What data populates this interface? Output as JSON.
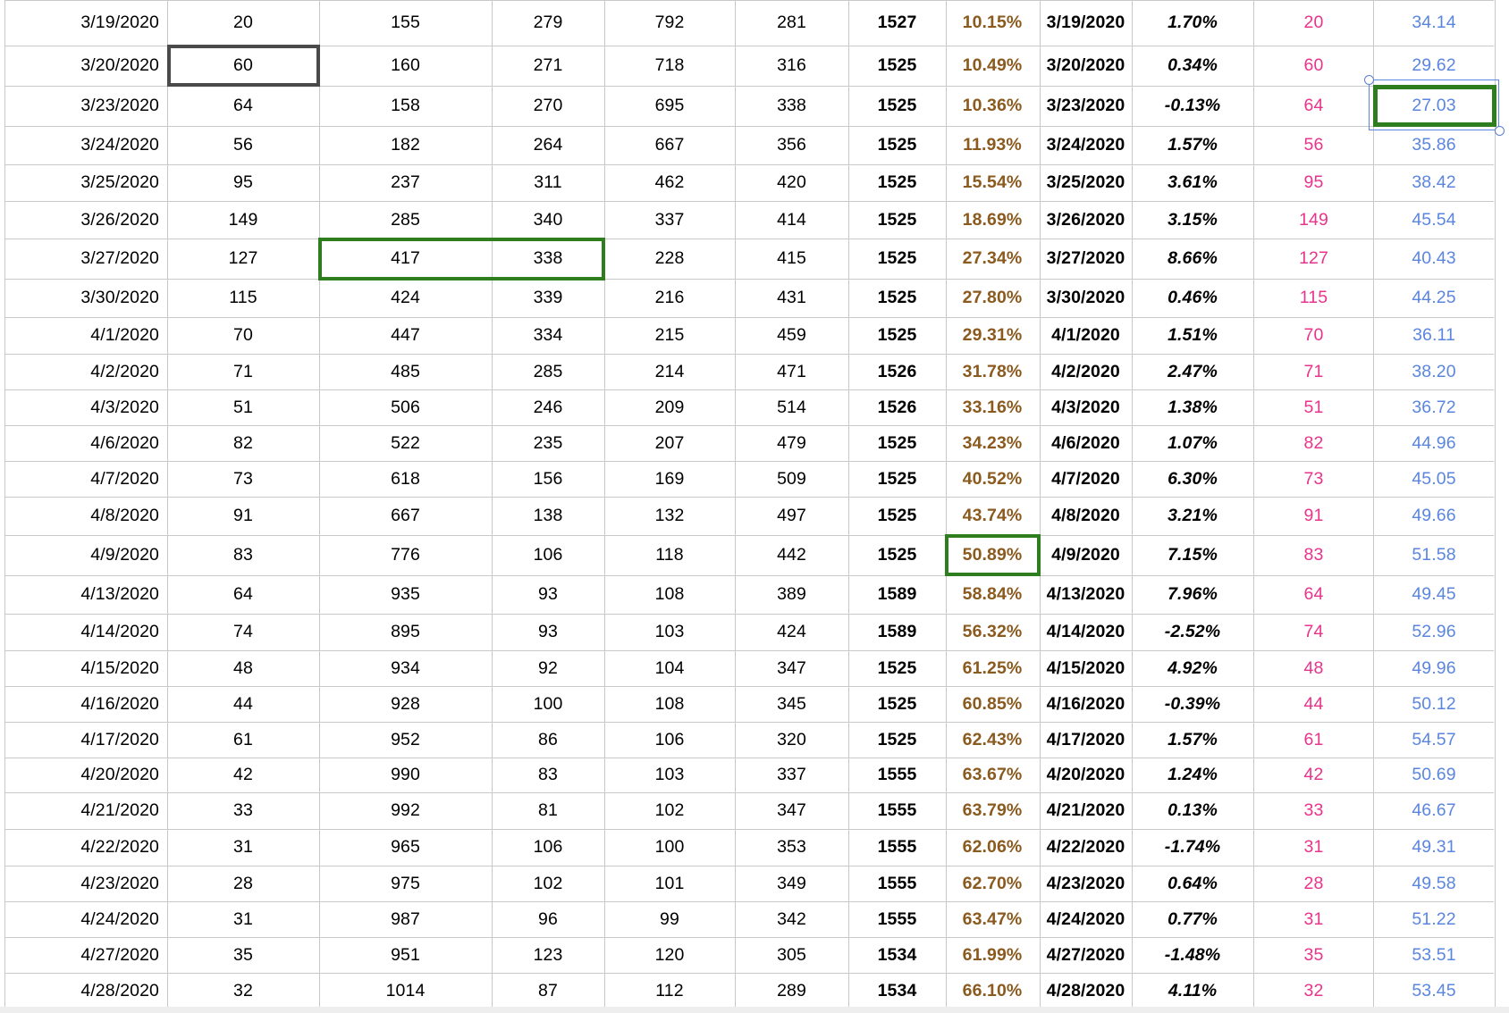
{
  "colors": {
    "text": "#000000",
    "percent_brown": "#8b5a1e",
    "pink": "#e8348c",
    "blue": "#5b86e0",
    "grid_line": "#c9c9c9",
    "green_border": "#2e7d1f",
    "dark_border": "#4a4a4a"
  },
  "rows": [
    {
      "date": "3/19/2020",
      "a": "20",
      "b": "155",
      "c": "279",
      "d": "792",
      "e": "281",
      "total": "1527",
      "pct": "10.15%",
      "date2": "3/19/2020",
      "chg": "1.70%",
      "pink": "20",
      "blue": "34.14"
    },
    {
      "date": "3/20/2020",
      "a": "60",
      "b": "160",
      "c": "271",
      "d": "718",
      "e": "316",
      "total": "1525",
      "pct": "10.49%",
      "date2": "3/20/2020",
      "chg": "0.34%",
      "pink": "60",
      "blue": "29.62"
    },
    {
      "date": "3/23/2020",
      "a": "64",
      "b": "158",
      "c": "270",
      "d": "695",
      "e": "338",
      "total": "1525",
      "pct": "10.36%",
      "date2": "3/23/2020",
      "chg": "-0.13%",
      "pink": "64",
      "blue": "27.03"
    },
    {
      "date": "3/24/2020",
      "a": "56",
      "b": "182",
      "c": "264",
      "d": "667",
      "e": "356",
      "total": "1525",
      "pct": "11.93%",
      "date2": "3/24/2020",
      "chg": "1.57%",
      "pink": "56",
      "blue": "35.86"
    },
    {
      "date": "3/25/2020",
      "a": "95",
      "b": "237",
      "c": "311",
      "d": "462",
      "e": "420",
      "total": "1525",
      "pct": "15.54%",
      "date2": "3/25/2020",
      "chg": "3.61%",
      "pink": "95",
      "blue": "38.42"
    },
    {
      "date": "3/26/2020",
      "a": "149",
      "b": "285",
      "c": "340",
      "d": "337",
      "e": "414",
      "total": "1525",
      "pct": "18.69%",
      "date2": "3/26/2020",
      "chg": "3.15%",
      "pink": "149",
      "blue": "45.54"
    },
    {
      "date": "3/27/2020",
      "a": "127",
      "b": "417",
      "c": "338",
      "d": "228",
      "e": "415",
      "total": "1525",
      "pct": "27.34%",
      "date2": "3/27/2020",
      "chg": "8.66%",
      "pink": "127",
      "blue": "40.43"
    },
    {
      "date": "3/30/2020",
      "a": "115",
      "b": "424",
      "c": "339",
      "d": "216",
      "e": "431",
      "total": "1525",
      "pct": "27.80%",
      "date2": "3/30/2020",
      "chg": "0.46%",
      "pink": "115",
      "blue": "44.25"
    },
    {
      "date": "4/1/2020",
      "a": "70",
      "b": "447",
      "c": "334",
      "d": "215",
      "e": "459",
      "total": "1525",
      "pct": "29.31%",
      "date2": "4/1/2020",
      "chg": "1.51%",
      "pink": "70",
      "blue": "36.11"
    },
    {
      "date": "4/2/2020",
      "a": "71",
      "b": "485",
      "c": "285",
      "d": "214",
      "e": "471",
      "total": "1526",
      "pct": "31.78%",
      "date2": "4/2/2020",
      "chg": "2.47%",
      "pink": "71",
      "blue": "38.20"
    },
    {
      "date": "4/3/2020",
      "a": "51",
      "b": "506",
      "c": "246",
      "d": "209",
      "e": "514",
      "total": "1526",
      "pct": "33.16%",
      "date2": "4/3/2020",
      "chg": "1.38%",
      "pink": "51",
      "blue": "36.72"
    },
    {
      "date": "4/6/2020",
      "a": "82",
      "b": "522",
      "c": "235",
      "d": "207",
      "e": "479",
      "total": "1525",
      "pct": "34.23%",
      "date2": "4/6/2020",
      "chg": "1.07%",
      "pink": "82",
      "blue": "44.96"
    },
    {
      "date": "4/7/2020",
      "a": "73",
      "b": "618",
      "c": "156",
      "d": "169",
      "e": "509",
      "total": "1525",
      "pct": "40.52%",
      "date2": "4/7/2020",
      "chg": "6.30%",
      "pink": "73",
      "blue": "45.05"
    },
    {
      "date": "4/8/2020",
      "a": "91",
      "b": "667",
      "c": "138",
      "d": "132",
      "e": "497",
      "total": "1525",
      "pct": "43.74%",
      "date2": "4/8/2020",
      "chg": "3.21%",
      "pink": "91",
      "blue": "49.66"
    },
    {
      "date": "4/9/2020",
      "a": "83",
      "b": "776",
      "c": "106",
      "d": "118",
      "e": "442",
      "total": "1525",
      "pct": "50.89%",
      "date2": "4/9/2020",
      "chg": "7.15%",
      "pink": "83",
      "blue": "51.58"
    },
    {
      "date": "4/13/2020",
      "a": "64",
      "b": "935",
      "c": "93",
      "d": "108",
      "e": "389",
      "total": "1589",
      "pct": "58.84%",
      "date2": "4/13/2020",
      "chg": "7.96%",
      "pink": "64",
      "blue": "49.45"
    },
    {
      "date": "4/14/2020",
      "a": "74",
      "b": "895",
      "c": "93",
      "d": "103",
      "e": "424",
      "total": "1589",
      "pct": "56.32%",
      "date2": "4/14/2020",
      "chg": "-2.52%",
      "pink": "74",
      "blue": "52.96"
    },
    {
      "date": "4/15/2020",
      "a": "48",
      "b": "934",
      "c": "92",
      "d": "104",
      "e": "347",
      "total": "1525",
      "pct": "61.25%",
      "date2": "4/15/2020",
      "chg": "4.92%",
      "pink": "48",
      "blue": "49.96"
    },
    {
      "date": "4/16/2020",
      "a": "44",
      "b": "928",
      "c": "100",
      "d": "108",
      "e": "345",
      "total": "1525",
      "pct": "60.85%",
      "date2": "4/16/2020",
      "chg": "-0.39%",
      "pink": "44",
      "blue": "50.12"
    },
    {
      "date": "4/17/2020",
      "a": "61",
      "b": "952",
      "c": "86",
      "d": "106",
      "e": "320",
      "total": "1525",
      "pct": "62.43%",
      "date2": "4/17/2020",
      "chg": "1.57%",
      "pink": "61",
      "blue": "54.57"
    },
    {
      "date": "4/20/2020",
      "a": "42",
      "b": "990",
      "c": "83",
      "d": "103",
      "e": "337",
      "total": "1555",
      "pct": "63.67%",
      "date2": "4/20/2020",
      "chg": "1.24%",
      "pink": "42",
      "blue": "50.69"
    },
    {
      "date": "4/21/2020",
      "a": "33",
      "b": "992",
      "c": "81",
      "d": "102",
      "e": "347",
      "total": "1555",
      "pct": "63.79%",
      "date2": "4/21/2020",
      "chg": "0.13%",
      "pink": "33",
      "blue": "46.67"
    },
    {
      "date": "4/22/2020",
      "a": "31",
      "b": "965",
      "c": "106",
      "d": "100",
      "e": "353",
      "total": "1555",
      "pct": "62.06%",
      "date2": "4/22/2020",
      "chg": "-1.74%",
      "pink": "31",
      "blue": "49.31"
    },
    {
      "date": "4/23/2020",
      "a": "28",
      "b": "975",
      "c": "102",
      "d": "101",
      "e": "349",
      "total": "1555",
      "pct": "62.70%",
      "date2": "4/23/2020",
      "chg": "0.64%",
      "pink": "28",
      "blue": "49.58"
    },
    {
      "date": "4/24/2020",
      "a": "31",
      "b": "987",
      "c": "96",
      "d": "99",
      "e": "342",
      "total": "1555",
      "pct": "63.47%",
      "date2": "4/24/2020",
      "chg": "0.77%",
      "pink": "31",
      "blue": "51.22"
    },
    {
      "date": "4/27/2020",
      "a": "35",
      "b": "951",
      "c": "123",
      "d": "120",
      "e": "305",
      "total": "1534",
      "pct": "61.99%",
      "date2": "4/27/2020",
      "chg": "-1.48%",
      "pink": "35",
      "blue": "53.51"
    },
    {
      "date": "4/28/2020",
      "a": "32",
      "b": "1014",
      "c": "87",
      "d": "112",
      "e": "289",
      "total": "1534",
      "pct": "66.10%",
      "date2": "4/28/2020",
      "chg": "4.11%",
      "pink": "32",
      "blue": "53.45"
    }
  ]
}
